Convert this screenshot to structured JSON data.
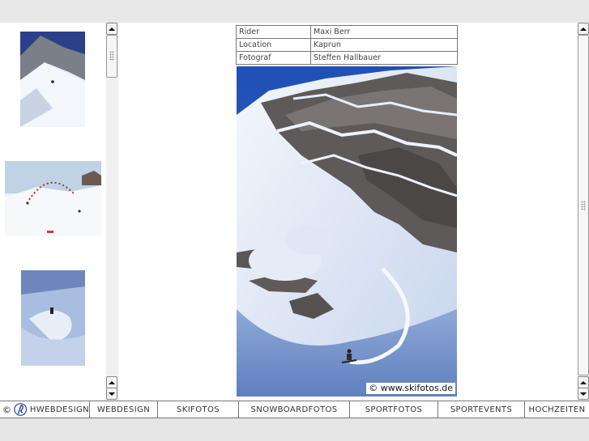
{
  "info": {
    "rows": [
      {
        "key": "Rider",
        "value": "Maxi Berr"
      },
      {
        "key": "Location",
        "value": "Kaprun"
      },
      {
        "key": "Fotograf",
        "value": "Steffen Hallbauer"
      }
    ]
  },
  "photo": {
    "copyright": "© www.skifotos.de"
  },
  "thumbnails": [
    {
      "icon": "thumbnail-steep-slope"
    },
    {
      "icon": "thumbnail-jump-sequence"
    },
    {
      "icon": "thumbnail-powder-turn"
    }
  ],
  "nav": {
    "copyright_symbol": "©",
    "brand": "HWEBDESIGN",
    "items": [
      "WEBDESIGN",
      "SKIFOTOS",
      "SNOWBOARDFOTOS",
      "SPORTFOTOS",
      "SPORTEVENTS",
      "HOCHZEITEN"
    ]
  },
  "colors": {
    "nav_border": "#777777",
    "logo_blue": "#2f3fa8",
    "sky_blue": "#2b5fbf"
  }
}
